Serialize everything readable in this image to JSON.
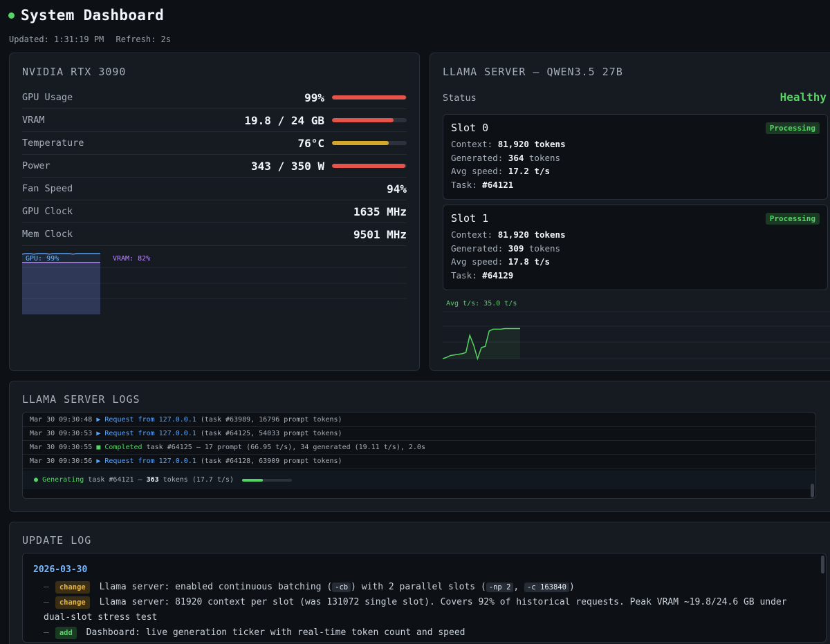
{
  "header": {
    "title": "System Dashboard",
    "updated": "Updated: 1:31:19 PM",
    "refresh": "Refresh: 2s"
  },
  "colors": {
    "accent_green": "#56d364",
    "bar_red": "#e5534b",
    "bar_amber": "#d4a72c",
    "gpu_line": "#58a6ff",
    "vram_line": "#bc8cff"
  },
  "gpu": {
    "title": "NVIDIA RTX 3090",
    "metrics": [
      {
        "label": "GPU Usage",
        "value": "99%",
        "percent": 99,
        "color": "#e5534b"
      },
      {
        "label": "VRAM",
        "value": "19.8 / 24 GB",
        "percent": 82,
        "color": "#e5534b"
      },
      {
        "label": "Temperature",
        "value": "76°C",
        "percent": 76,
        "color": "#d4a72c"
      },
      {
        "label": "Power",
        "value": "343 / 350 W",
        "percent": 98,
        "color": "#e5534b"
      },
      {
        "label": "Fan Speed",
        "value": "94%"
      },
      {
        "label": "GPU Clock",
        "value": "1635 MHz"
      },
      {
        "label": "Mem Clock",
        "value": "9501 MHz"
      }
    ],
    "chart": {
      "gpu_label": "GPU: 99%",
      "vram_label": "VRAM: 82%"
    }
  },
  "llama": {
    "title": "LLAMA SERVER — QWEN3.5 27B",
    "status_label": "Status",
    "status_value": "Healthy",
    "slots": [
      {
        "title": "Slot 0",
        "badge": "Processing",
        "context_label": "Context:",
        "context_value": "81,920",
        "context_unit": "tokens",
        "generated_label": "Generated:",
        "generated_value": "364",
        "generated_unit": "tokens",
        "speed_label": "Avg speed:",
        "speed_value": "17.2 t/s",
        "task_label": "Task:",
        "task_value": "#64121"
      },
      {
        "title": "Slot 1",
        "badge": "Processing",
        "context_label": "Context:",
        "context_value": "81,920",
        "context_unit": "tokens",
        "generated_label": "Generated:",
        "generated_value": "309",
        "generated_unit": "tokens",
        "speed_label": "Avg speed:",
        "speed_value": "17.8 t/s",
        "task_label": "Task:",
        "task_value": "#64129"
      }
    ],
    "speed_chart_label": "Avg t/s: 35.0 t/s"
  },
  "chart_data": [
    {
      "type": "area",
      "series": [
        {
          "name": "GPU",
          "values": [
            98,
            99,
            99,
            98,
            99,
            99,
            99,
            98,
            99,
            99,
            99,
            99,
            99,
            98,
            99,
            99,
            99,
            99,
            99,
            99,
            99
          ]
        },
        {
          "name": "VRAM",
          "values": [
            82,
            82,
            82,
            82,
            82,
            82,
            82,
            82,
            82,
            82,
            82,
            82,
            82,
            82,
            82,
            82,
            82,
            82,
            82,
            82,
            82
          ]
        }
      ],
      "ylim": [
        0,
        100
      ]
    },
    {
      "type": "line",
      "series": [
        {
          "name": "Avg t/s",
          "values": [
            0,
            2,
            5,
            6,
            7,
            8,
            10,
            38,
            22,
            0,
            18,
            20,
            45,
            48,
            48,
            48,
            49,
            49,
            49,
            49,
            49
          ]
        }
      ],
      "ylim": [
        0,
        80
      ]
    }
  ],
  "logs": {
    "title": "LLAMA SERVER LOGS",
    "lines": [
      {
        "time": "Mar 30 09:30:48",
        "kind": "req",
        "event": "▶ Request from 127.0.0.1",
        "detail": " (task #63989, 16796 prompt tokens)"
      },
      {
        "time": "Mar 30 09:30:53",
        "kind": "req",
        "event": "▶ Request from 127.0.0.1",
        "detail": " (task #64125, 54033 prompt tokens)"
      },
      {
        "time": "Mar 30 09:30:55",
        "kind": "done",
        "event": "■ Completed",
        "detail": " task #64125 — 17 prompt (66.95 t/s), 34 generated (19.11 t/s), 2.0s"
      },
      {
        "time": "Mar 30 09:30:56",
        "kind": "req",
        "event": "▶ Request from 127.0.0.1",
        "detail": " (task #64128, 63909 prompt tokens)"
      }
    ],
    "generating": {
      "icon": "●",
      "label": "Generating",
      "task": " task #64121 — ",
      "tokens": "363",
      "rest": " tokens (17.7 t/s)",
      "progress": 0.42
    }
  },
  "update_log": {
    "title": "UPDATE LOG",
    "date": "2026-03-30",
    "items": [
      {
        "tag": "change",
        "text1": "Llama server: enabled continuous batching (",
        "code1": "-cb",
        "text2": ") with 2 parallel slots (",
        "code2": "-np 2",
        "text3": ", ",
        "code3": "-c 163840",
        "text4": ")"
      },
      {
        "tag": "change",
        "text": "Llama server: 81920 context per slot (was 131072 single slot). Covers 92% of historical requests. Peak VRAM ~19.8/24.6 GB under dual-slot stress test"
      },
      {
        "tag": "add",
        "text": "Dashboard: live generation ticker with real-time token count and speed"
      }
    ]
  }
}
